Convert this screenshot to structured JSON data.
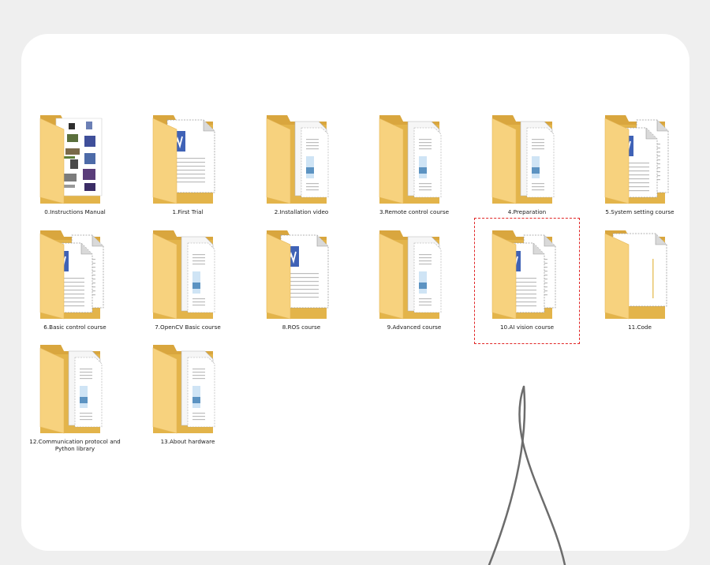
{
  "folders": [
    {
      "label": "0.Instructions Manual",
      "style": "manual"
    },
    {
      "label": "1.First Trial",
      "style": "word"
    },
    {
      "label": "2.Installation video",
      "style": "pictures"
    },
    {
      "label": "3.Remote control course",
      "style": "pictures"
    },
    {
      "label": "4.Preparation",
      "style": "pictures"
    },
    {
      "label": "5.System setting course",
      "style": "docs"
    },
    {
      "label": "6.Basic control course",
      "style": "docs"
    },
    {
      "label": "7.OpenCV Basic course",
      "style": "pictures"
    },
    {
      "label": "8.ROS course",
      "style": "word"
    },
    {
      "label": "9.Advanced course",
      "style": "pictures"
    },
    {
      "label": "10.AI vision course",
      "style": "docs",
      "selected": true
    },
    {
      "label": "11.Code",
      "style": "blank"
    },
    {
      "label": "12.Communication protocol and Python library",
      "style": "pictures"
    },
    {
      "label": "13.About hardware",
      "style": "pictures"
    }
  ],
  "icons": {
    "folder": "folder-icon",
    "word": "word-document-icon",
    "pictures": "picture-document-icon",
    "docs": "document-icon",
    "blank": "blank-file-icon",
    "manual": "manual-images-icon"
  },
  "colors": {
    "folder_back": "#e3b44a",
    "folder_front": "#f7d27e",
    "word_blue": "#3f62b6",
    "highlight": "#e12626",
    "callout_line": "#6c6c6c"
  }
}
